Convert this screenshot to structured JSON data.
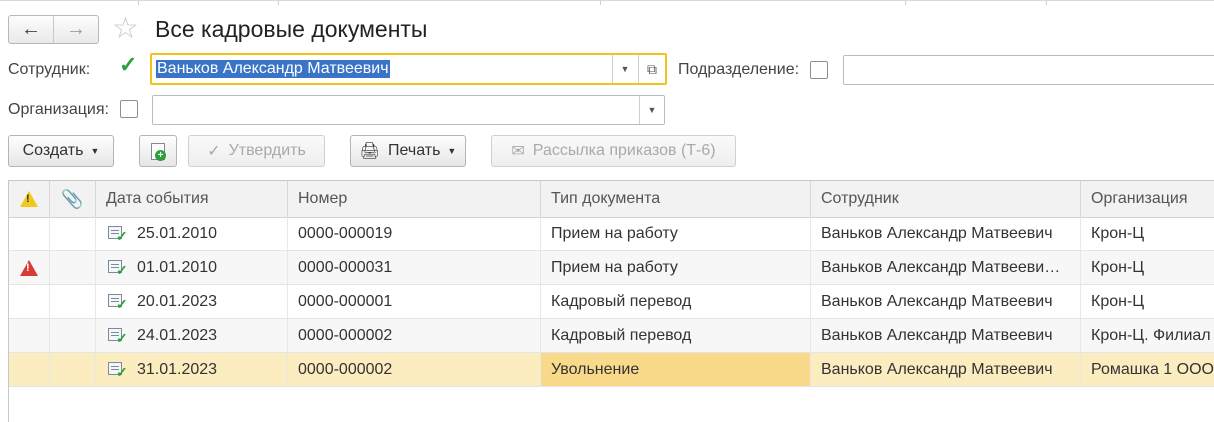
{
  "header": {
    "back_icon": "arrow-left-icon",
    "forward_icon": "arrow-right-icon",
    "favorite_icon": "star-icon",
    "title": "Все кадровые документы"
  },
  "filters": {
    "employee_label": "Сотрудник:",
    "employee_checked": true,
    "employee_value": "Ваньков Александр Матвеевич",
    "department_label": "Подразделение:",
    "department_checked": false,
    "department_value": "",
    "organization_label": "Организация:",
    "organization_checked": false,
    "organization_value": ""
  },
  "toolbar": {
    "create_label": "Создать",
    "approve_label": "Утвердить",
    "print_label": "Печать",
    "mailing_label": "Рассылка приказов (Т-6)"
  },
  "table": {
    "columns": [
      "Дата события",
      "Номер",
      "Тип документа",
      "Сотрудник",
      "Организация"
    ],
    "rows": [
      {
        "warning": "",
        "date": "25.01.2010",
        "number": "0000-000019",
        "type": "Прием на работу",
        "employee": "Ваньков Александр Матвеевич",
        "org": "Крон-Ц"
      },
      {
        "warning": "error",
        "date": "01.01.2010",
        "number": "0000-000031",
        "type": "Прием на работу",
        "employee": "Ваньков Александр Матвееви…",
        "org": "Крон-Ц"
      },
      {
        "warning": "",
        "date": "20.01.2023",
        "number": "0000-000001",
        "type": "Кадровый перевод",
        "employee": "Ваньков Александр Матвеевич",
        "org": "Крон-Ц"
      },
      {
        "warning": "",
        "date": "24.01.2023",
        "number": "0000-000002",
        "type": "Кадровый перевод",
        "employee": "Ваньков Александр Матвеевич",
        "org": "Крон-Ц. Филиал"
      },
      {
        "warning": "",
        "date": "31.01.2023",
        "number": "0000-000002",
        "type": "Увольнение",
        "employee": "Ваньков Александр Матвеевич",
        "org": "Ромашка 1 ООО"
      }
    ],
    "selected_row": 4
  },
  "colors": {
    "accent_focus": "#f0c419",
    "selection_row": "#fbedbf",
    "selection_cell": "#f9d98a",
    "check_green": "#2aa139",
    "warning_yellow": "#f2c81f",
    "error_red": "#d83a34"
  }
}
